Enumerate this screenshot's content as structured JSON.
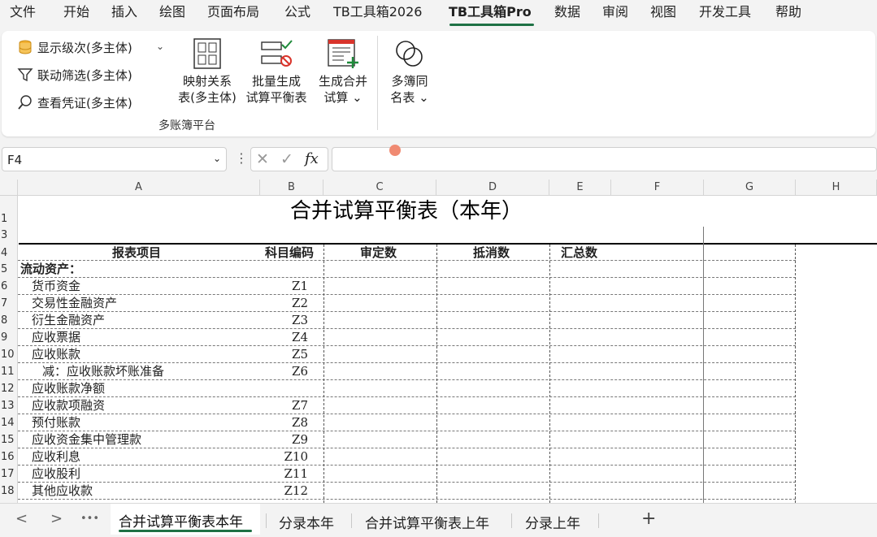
{
  "menu": {
    "items": [
      "文件",
      "开始",
      "插入",
      "绘图",
      "页面布局",
      "公式",
      "TB工具箱2026",
      "TB工具箱Pro",
      "数据",
      "审阅",
      "视图",
      "开发工具",
      "帮助"
    ],
    "active_index": 7
  },
  "ribbon": {
    "small_buttons": [
      "显示级次(多主体)",
      "联动筛选(多主体)",
      "查看凭证(多主体)"
    ],
    "big_buttons": [
      {
        "line1": "映射关系",
        "line2": "表(多主体)"
      },
      {
        "line1": "批量生成",
        "line2": "试算平衡表"
      },
      {
        "line1": "生成合并",
        "line2": "试算 ⌄"
      },
      {
        "line1": "多簿同",
        "line2": "名表 ⌄"
      }
    ],
    "group_label": "多账簿平台",
    "caret": "⌄"
  },
  "formula_bar": {
    "name_box": "F4",
    "name_caret": "⌄",
    "dots": "⋮",
    "cancel": "✕",
    "confirm": "✓",
    "fx": "fx",
    "value": ""
  },
  "grid": {
    "columns": [
      "A",
      "B",
      "C",
      "D",
      "E",
      "F",
      "G",
      "H"
    ],
    "row_numbers": [
      "1",
      "3",
      "4",
      "5",
      "6",
      "7",
      "8",
      "9",
      "10",
      "11",
      "12",
      "13",
      "14",
      "15",
      "16",
      "17",
      "18"
    ],
    "title": "合并试算平衡表（本年）",
    "headers": [
      "报表项目",
      "科目编码",
      "审定数",
      "抵消数",
      "汇总数"
    ],
    "rows": [
      {
        "item": "流动资产：",
        "code": "",
        "bold": true,
        "indent": 0
      },
      {
        "item": "货币资金",
        "code": "Z1",
        "indent": 1
      },
      {
        "item": "交易性金融资产",
        "code": "Z2",
        "indent": 1
      },
      {
        "item": "衍生金融资产",
        "code": "Z3",
        "indent": 1
      },
      {
        "item": "应收票据",
        "code": "Z4",
        "indent": 1
      },
      {
        "item": "应收账款",
        "code": "Z5",
        "indent": 1
      },
      {
        "item": "减：应收账款坏账准备",
        "code": "Z6",
        "indent": 2
      },
      {
        "item": "应收账款净额",
        "code": "",
        "indent": 1
      },
      {
        "item": "应收款项融资",
        "code": "Z7",
        "indent": 1
      },
      {
        "item": "预付账款",
        "code": "Z8",
        "indent": 1
      },
      {
        "item": "应收资金集中管理款",
        "code": "Z9",
        "indent": 1
      },
      {
        "item": "应收利息",
        "code": "Z10",
        "indent": 1
      },
      {
        "item": "应收股利",
        "code": "Z11",
        "indent": 1
      },
      {
        "item": "其他应收款",
        "code": "Z12",
        "indent": 1
      }
    ]
  },
  "sheet_tabs": {
    "nav": [
      "<",
      ">",
      "•••"
    ],
    "tabs": [
      "合并试算平衡表本年",
      "分录本年",
      "合并试算平衡表上年",
      "分录上年"
    ],
    "active_index": 0,
    "add": "+"
  }
}
